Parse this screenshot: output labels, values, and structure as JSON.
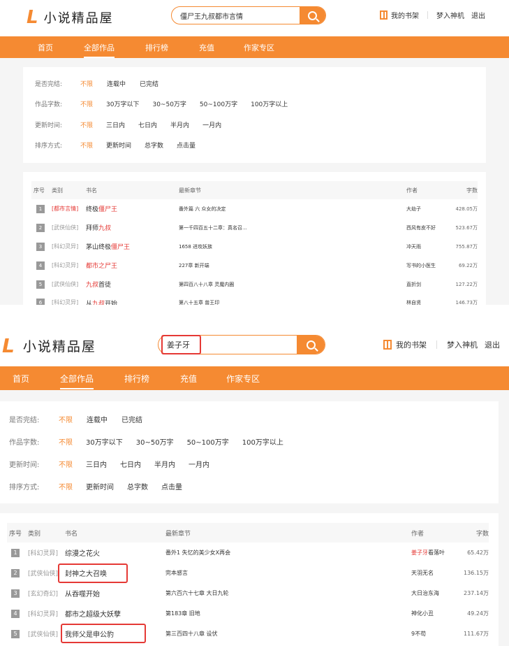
{
  "brand": {
    "mark": "L",
    "name": "小说精品屋"
  },
  "header": {
    "bookshelf": "我的书架",
    "user": "梦入神机",
    "logout": "退出"
  },
  "nav": [
    "首页",
    "全部作品",
    "排行榜",
    "充值",
    "作家专区"
  ],
  "filters": [
    {
      "label": "是否完结:",
      "options": [
        "不限",
        "连载中",
        "已完结"
      ]
    },
    {
      "label": "作品字数:",
      "options": [
        "不限",
        "30万字以下",
        "30~50万字",
        "50~100万字",
        "100万字以上"
      ]
    },
    {
      "label": "更新时间:",
      "options": [
        "不限",
        "三日内",
        "七日内",
        "半月内",
        "一月内"
      ]
    },
    {
      "label": "排序方式:",
      "options": [
        "不限",
        "更新时间",
        "总字数",
        "点击量"
      ]
    }
  ],
  "columns": [
    "序号",
    "类别",
    "书名",
    "最新章节",
    "作者",
    "字数"
  ],
  "top": {
    "search_value": "僵尸王九叔都市言情",
    "rows": [
      {
        "no": "1",
        "cat": "[都市言情]",
        "title_pre": "终极",
        "title_hl": "僵尸王",
        "title_post": "",
        "chapter": "番外篇 六 众女的决定",
        "author": "大劫子",
        "words": "428.05万"
      },
      {
        "no": "2",
        "cat": "[武侠仙侠]",
        "title_pre": "拜师",
        "title_hl": "九叔",
        "title_post": "",
        "chapter": "第一千四百五十二章：真名召...",
        "author": "西风有皮不好",
        "words": "523.67万"
      },
      {
        "no": "3",
        "cat": "[科幻灵异]",
        "title_pre": "茅山终极",
        "title_hl": "僵尸王",
        "title_post": "",
        "chapter": "1658 进攻妖族",
        "author": "冲天雨",
        "words": "755.87万"
      },
      {
        "no": "4",
        "cat": "[科幻灵异]",
        "title_pre": "",
        "title_hl": "都市之尸王",
        "title_post": "",
        "chapter": "227章 新开端",
        "author": "写书的小医生",
        "words": "69.22万"
      },
      {
        "no": "5",
        "cat": "[武侠仙侠]",
        "title_pre": "",
        "title_hl": "九叔",
        "title_post": "首徒",
        "chapter": "第四百八十八章 灵魔内圈",
        "author": "直折剑",
        "words": "127.22万"
      },
      {
        "no": "6",
        "cat": "[科幻灵异]",
        "title_pre": "从",
        "title_hl": "九叔",
        "title_post": "开始",
        "chapter": "第八十五章 兽王印",
        "author": "林自贤",
        "words": "146.73万"
      }
    ]
  },
  "bottom": {
    "search_value": "姜子牙",
    "rows": [
      {
        "no": "1",
        "cat": "[科幻灵异]",
        "title": "综漫之花火",
        "chapter": "番外1 失忆的美少女X再会",
        "author_hl": "姜子牙",
        "author_post": "看落叶",
        "words": "65.42万"
      },
      {
        "no": "2",
        "cat": "[武侠仙侠]",
        "title": "封神之大召唤",
        "chapter": "完本感言",
        "author_hl": "",
        "author_post": "天羽无名",
        "words": "136.15万"
      },
      {
        "no": "3",
        "cat": "[玄幻奇幻]",
        "title": "从吞噬开始",
        "chapter": "第六百六十七章 大日九轮",
        "author_hl": "",
        "author_post": "大日治东海",
        "words": "237.14万"
      },
      {
        "no": "4",
        "cat": "[科幻灵异]",
        "title": "都市之超级大妖孽",
        "chapter": "第183章 旧地",
        "author_hl": "",
        "author_post": "神化小丑",
        "words": "49.24万"
      },
      {
        "no": "5",
        "cat": "[武侠仙侠]",
        "title": "我师父是申公豹",
        "chapter": "第三百四十八章 设伏",
        "author_hl": "",
        "author_post": "9不苟",
        "words": "111.67万"
      }
    ]
  }
}
